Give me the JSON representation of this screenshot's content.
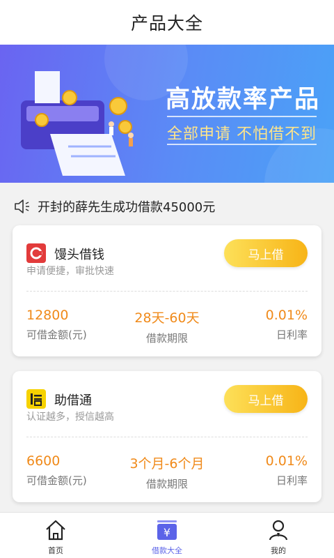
{
  "header": {
    "title": "产品大全"
  },
  "banner": {
    "title": "高放款率产品",
    "subtitle": "全部申请  不怕借不到"
  },
  "notice": {
    "text": "开封的薛先生成功借款45000元"
  },
  "products": [
    {
      "name": "馒头借钱",
      "desc": "申请便捷，审批快速",
      "apply_label": "马上借",
      "amount": "12800",
      "amount_label": "可借金额(元)",
      "term": "28天-60天",
      "term_label": "借款期限",
      "rate": "0.01%",
      "rate_label": "日利率"
    },
    {
      "name": "助借通",
      "desc": "认证越多，授信越高",
      "apply_label": "马上借",
      "amount": "6600",
      "amount_label": "可借金额(元)",
      "term": "3个月-6个月",
      "term_label": "借款期限",
      "rate": "0.01%",
      "rate_label": "日利率"
    }
  ],
  "tabs": [
    {
      "label": "首页",
      "icon": "home-icon"
    },
    {
      "label": "借款大全",
      "icon": "yuan-icon"
    },
    {
      "label": "我的",
      "icon": "user-icon"
    }
  ],
  "colors": {
    "accent": "#5b63e8",
    "orange": "#f08a1a",
    "button": "#f7b417"
  }
}
